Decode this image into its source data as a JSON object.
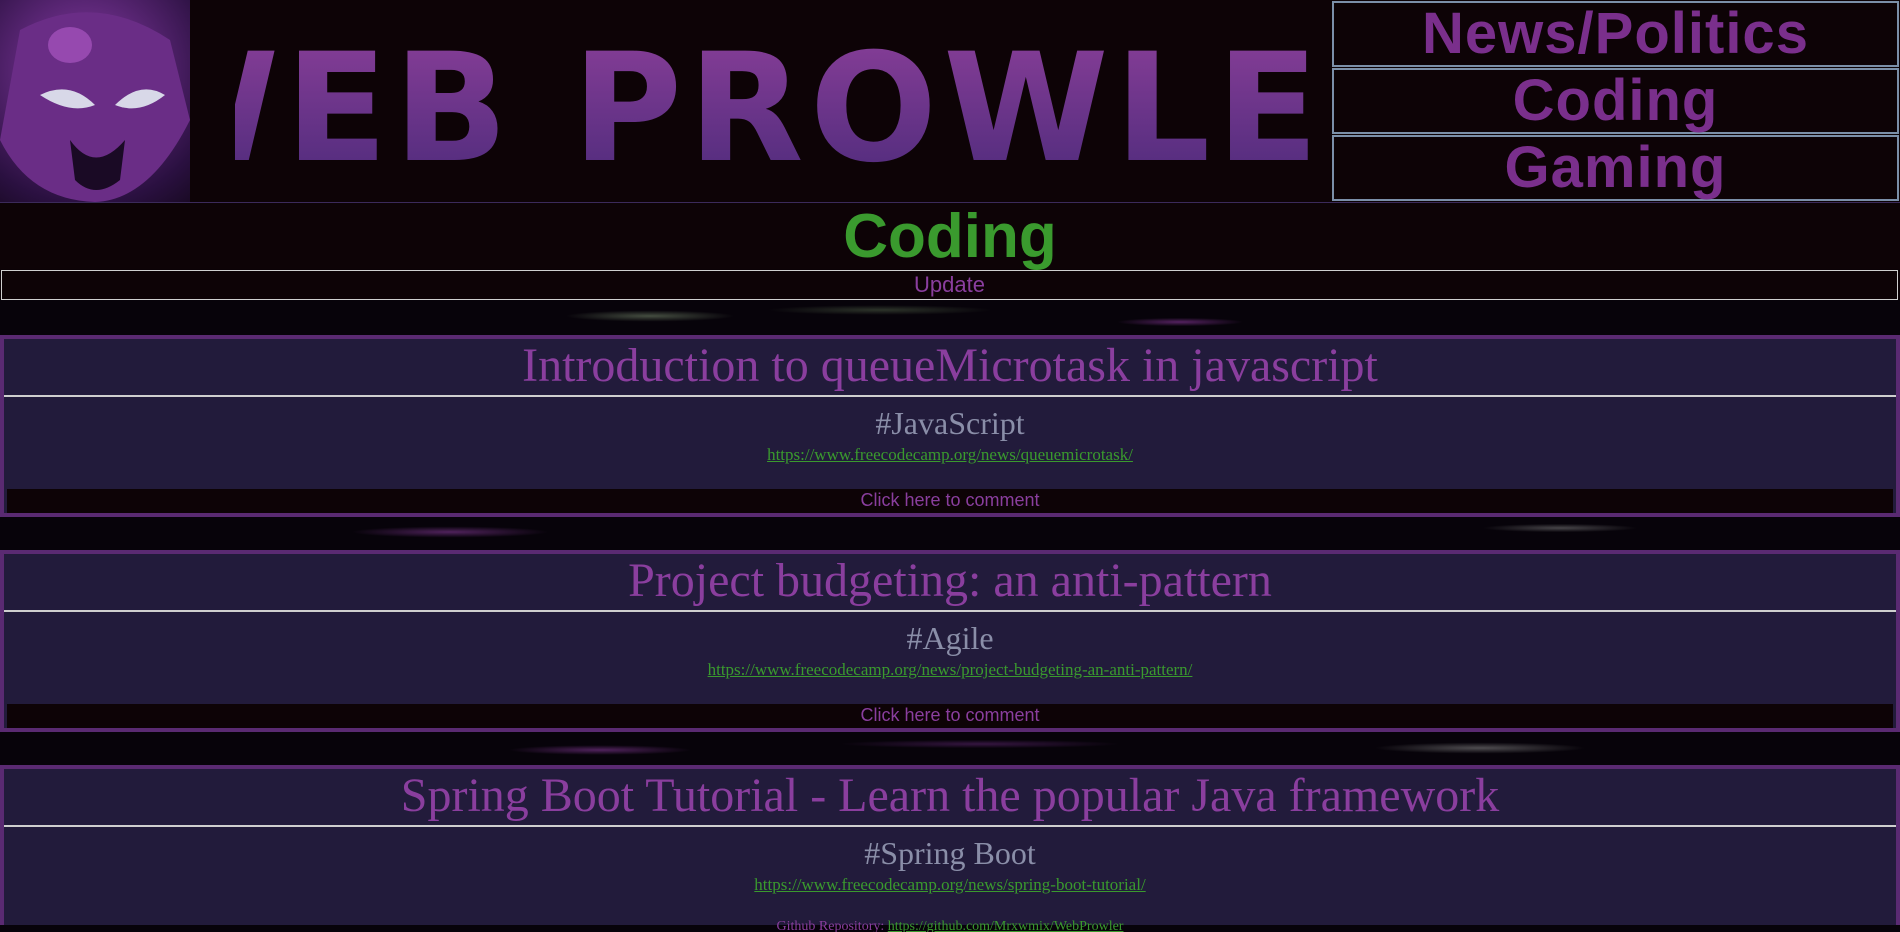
{
  "header": {
    "logo_text": "WEB PROWLER",
    "nav": [
      {
        "label": "News/Politics"
      },
      {
        "label": "Coding"
      },
      {
        "label": "Gaming"
      }
    ]
  },
  "page": {
    "title": "Coding",
    "update_label": "Update"
  },
  "posts": [
    {
      "title": "Introduction to queueMicrotask in javascript",
      "tag": "#JavaScript",
      "link": "https://www.freecodecamp.org/news/queuemicrotask/",
      "comment_label": "Click here to comment"
    },
    {
      "title": "Project budgeting: an anti-pattern",
      "tag": "#Agile",
      "link": "https://www.freecodecamp.org/news/project-budgeting-an-anti-pattern/",
      "comment_label": "Click here to comment"
    },
    {
      "title": "Spring Boot Tutorial - Learn the popular Java framework",
      "tag": "#Spring Boot",
      "link": "https://www.freecodecamp.org/news/spring-boot-tutorial/"
    }
  ],
  "footer": {
    "label": "Github Repository:",
    "link": "https://github.com/Mrxwmix/WebProwler"
  },
  "colors": {
    "accent_purple": "#8a3e9e",
    "accent_green": "#3a9a2e",
    "card_bg": "#221b3b"
  }
}
